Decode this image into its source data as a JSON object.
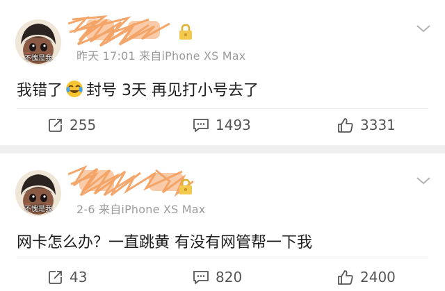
{
  "comments": [
    {
      "avatar_tag": "不愧是我",
      "meta": "昨天 17:01  来自iPhone XS Max",
      "text_before_emoji": "我错了",
      "emoji": "crying-laughing-emoji",
      "text_after_emoji": "封号 3天 再见打小号去了",
      "actions": {
        "share": "255",
        "comment": "1493",
        "like": "3331"
      }
    },
    {
      "avatar_tag": "不愧是我",
      "meta": "2-6  来自iPhone XS Max",
      "text": "网卡怎么办？一直跳黄 有没有网管帮一下我",
      "actions": {
        "share": "43",
        "comment": "820",
        "like": "2400"
      }
    }
  ],
  "icons": {
    "share": "share-edit-icon",
    "comment": "comment-icon",
    "like": "thumbs-up-icon",
    "expand": "chevron-down-icon",
    "lock": "lock-icon"
  },
  "colors": {
    "background": "#efefef",
    "card": "#ffffff",
    "meta_text": "#9a9a9a",
    "scribble": "#f08a3c",
    "lock": "#f2c94c"
  }
}
